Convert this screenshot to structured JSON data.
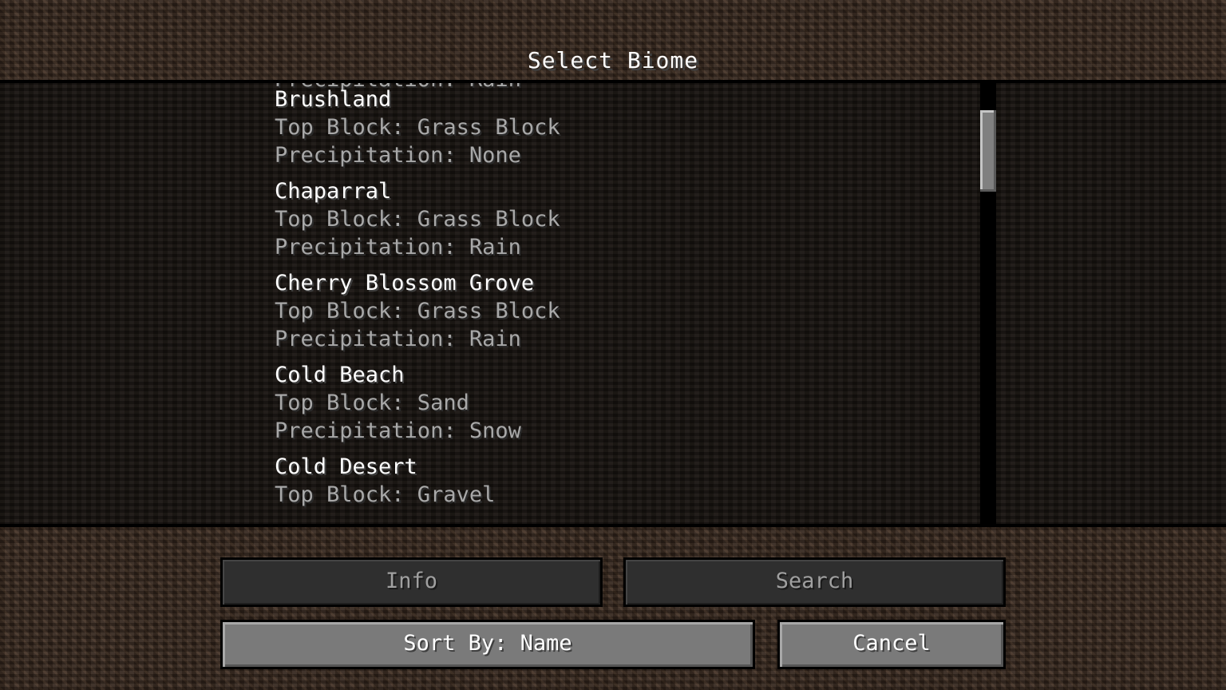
{
  "screen": {
    "title": "Select Biome"
  },
  "biome_list": {
    "top_partial_precipitation": "Precipitation: Rain",
    "entries": [
      {
        "name": "Brushland",
        "top_block": "Top Block: Grass Block",
        "precipitation": "Precipitation: None"
      },
      {
        "name": "Chaparral",
        "top_block": "Top Block: Grass Block",
        "precipitation": "Precipitation: Rain"
      },
      {
        "name": "Cherry Blossom Grove",
        "top_block": "Top Block: Grass Block",
        "precipitation": "Precipitation: Rain"
      },
      {
        "name": "Cold Beach",
        "top_block": "Top Block: Sand",
        "precipitation": "Precipitation: Snow"
      },
      {
        "name": "Cold Desert",
        "top_block": "Top Block: Gravel",
        "precipitation": ""
      }
    ]
  },
  "buttons": {
    "info": {
      "label": "Info",
      "enabled": false
    },
    "search": {
      "label": "Search",
      "enabled": false
    },
    "sort": {
      "label": "Sort By: Name",
      "enabled": true
    },
    "cancel": {
      "label": "Cancel",
      "enabled": true
    }
  },
  "colors": {
    "title_text": "#ffffff",
    "entry_name_text": "#ffffff",
    "entry_detail_text": "#a8a8a8",
    "disabled_button_text": "#a0a0a0",
    "enabled_button_text": "#ffffff"
  }
}
